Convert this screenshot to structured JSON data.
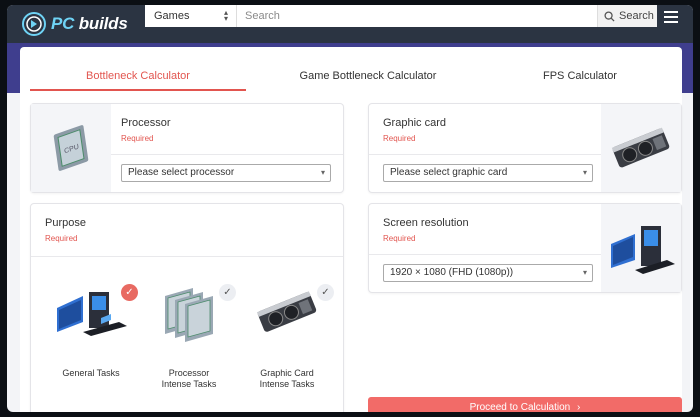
{
  "header": {
    "logo_text_pc": "PC",
    "logo_text_rest": " builds",
    "category": "Games",
    "search_placeholder": "Search",
    "search_button": "Search"
  },
  "tabs": [
    {
      "label": "Bottleneck Calculator",
      "active": true
    },
    {
      "label": "Game Bottleneck Calculator",
      "active": false
    },
    {
      "label": "FPS Calculator",
      "active": false
    }
  ],
  "processor": {
    "title": "Processor",
    "required": "Required",
    "select": "Please select processor"
  },
  "graphic_card": {
    "title": "Graphic card",
    "required": "Required",
    "select": "Please select graphic card"
  },
  "purpose": {
    "title": "Purpose",
    "required": "Required",
    "tasks": [
      {
        "label_line1": "General Tasks",
        "label_line2": "",
        "checked": true
      },
      {
        "label_line1": "Processor",
        "label_line2": "Intense Tasks",
        "checked": false
      },
      {
        "label_line1": "Graphic Card",
        "label_line2": "Intense Tasks",
        "checked": false
      }
    ]
  },
  "screen_resolution": {
    "title": "Screen resolution",
    "required": "Required",
    "select": "1920 × 1080 (FHD (1080p))"
  },
  "proceed_button": "Proceed to Calculation",
  "colors": {
    "accent": "#e2554f",
    "nav": "#2b3442",
    "banner": "#3f3e8e",
    "button": "#f26b68"
  }
}
